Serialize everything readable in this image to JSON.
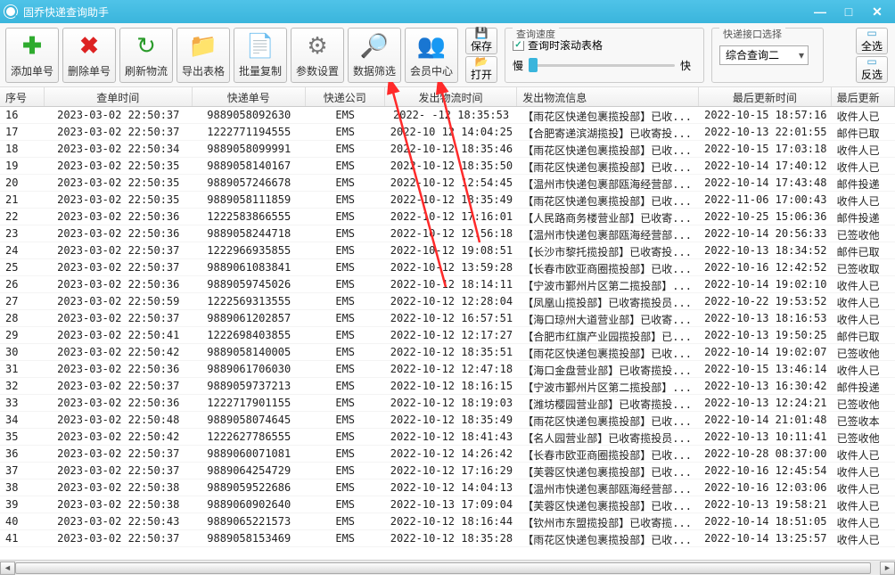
{
  "title": "固乔快递查询助手",
  "toolbar": {
    "add": "添加单号",
    "delete": "删除单号",
    "refresh": "刷新物流",
    "export": "导出表格",
    "copy": "批量复制",
    "settings": "参数设置",
    "filter": "数据筛选",
    "member": "会员中心",
    "save": "保存",
    "open": "打开",
    "selectAll": "全选",
    "invert": "反选"
  },
  "speed": {
    "label": "查询速度",
    "slow": "慢",
    "fast": "快",
    "scroll": "查询时滚动表格"
  },
  "interface": {
    "label": "快递接口选择",
    "value": "综合查询二"
  },
  "columns": [
    "序号",
    "查单时间",
    "快递单号",
    "快递公司",
    "发出物流时间",
    "发出物流信息",
    "最后更新时间",
    "最后更新"
  ],
  "rows": [
    [
      "16",
      "2023-03-02 22:50:37",
      "9889058092630",
      "EMS",
      "2022-  -12 18:35:53",
      "【雨花区快递包裹揽投部】已收...",
      "2022-10-15 18:57:16",
      "收件人已"
    ],
    [
      "17",
      "2023-03-02 22:50:37",
      "1222771194555",
      "EMS",
      "2022-10 12 14:04:25",
      "【合肥寄递滨湖揽投】已收寄投...",
      "2022-10-13 22:01:55",
      "邮件已取"
    ],
    [
      "18",
      "2023-03-02 22:50:34",
      "9889058099991",
      "EMS",
      "2022-10-12 18:35:46",
      "【雨花区快递包裹揽投部】已收...",
      "2022-10-15 17:03:18",
      "收件人已"
    ],
    [
      "19",
      "2023-03-02 22:50:35",
      "9889058140167",
      "EMS",
      "2022-10-12 18:35:50",
      "【雨花区快递包裹揽投部】已收...",
      "2022-10-14 17:40:12",
      "收件人已"
    ],
    [
      "20",
      "2023-03-02 22:50:35",
      "9889057246678",
      "EMS",
      "2022-10-12 12:54:45",
      "【温州市快递包裹部瓯海经营部...",
      "2022-10-14 17:43:48",
      "邮件投递"
    ],
    [
      "21",
      "2023-03-02 22:50:35",
      "9889058111859",
      "EMS",
      "2022-10-12 18:35:49",
      "【雨花区快递包裹揽投部】已收...",
      "2022-11-06 17:00:43",
      "收件人已"
    ],
    [
      "22",
      "2023-03-02 22:50:36",
      "1222583866555",
      "EMS",
      "2022-10-12 17:16:01",
      "【人民路商务楼营业部】已收寄...",
      "2022-10-25 15:06:36",
      "邮件投递"
    ],
    [
      "23",
      "2023-03-02 22:50:36",
      "9889058244718",
      "EMS",
      "2022-10-12 12:56:18",
      "【温州市快递包裹部瓯海经营部...",
      "2022-10-14 20:56:33",
      "已签收他"
    ],
    [
      "24",
      "2023-03-02 22:50:37",
      "1222966935855",
      "EMS",
      "2022-10-12 19:08:51",
      "【长沙市黎托揽投部】已收寄投...",
      "2022-10-13 18:34:52",
      "邮件已取"
    ],
    [
      "25",
      "2023-03-02 22:50:37",
      "9889061083841",
      "EMS",
      "2022-10-12 13:59:28",
      "【长春市欧亚商圈揽投部】已收...",
      "2022-10-16 12:42:52",
      "已签收取"
    ],
    [
      "26",
      "2023-03-02 22:50:36",
      "9889059745026",
      "EMS",
      "2022-10-12 18:14:11",
      "【宁波市鄞州片区第二揽投部】...",
      "2022-10-14 19:02:10",
      "收件人已"
    ],
    [
      "27",
      "2023-03-02 22:50:59",
      "1222569313555",
      "EMS",
      "2022-10-12 12:28:04",
      "【凤凰山揽投部】已收寄揽投员...",
      "2022-10-22 19:53:52",
      "收件人已"
    ],
    [
      "28",
      "2023-03-02 22:50:37",
      "9889061202857",
      "EMS",
      "2022-10-12 16:57:51",
      "【海口琼州大道营业部】已收寄...",
      "2022-10-13 18:16:53",
      "收件人已"
    ],
    [
      "29",
      "2023-03-02 22:50:41",
      "1222698403855",
      "EMS",
      "2022-10-12 12:17:27",
      "【合肥市红旗产业园揽投部】已...",
      "2022-10-13 19:50:25",
      "邮件已取"
    ],
    [
      "30",
      "2023-03-02 22:50:42",
      "9889058140005",
      "EMS",
      "2022-10-12 18:35:51",
      "【雨花区快递包裹揽投部】已收...",
      "2022-10-14 19:02:07",
      "已签收他"
    ],
    [
      "31",
      "2023-03-02 22:50:36",
      "9889061706030",
      "EMS",
      "2022-10-12 12:47:18",
      "【海口金盘营业部】已收寄揽投...",
      "2022-10-15 13:46:14",
      "收件人已"
    ],
    [
      "32",
      "2023-03-02 22:50:37",
      "9889059737213",
      "EMS",
      "2022-10-12 18:16:15",
      "【宁波市鄞州片区第二揽投部】...",
      "2022-10-13 16:30:42",
      "邮件投递"
    ],
    [
      "33",
      "2023-03-02 22:50:36",
      "1222717901155",
      "EMS",
      "2022-10-12 18:19:03",
      "【潍坊樱园营业部】已收寄揽投...",
      "2022-10-13 12:24:21",
      "已签收他"
    ],
    [
      "34",
      "2023-03-02 22:50:48",
      "9889058074645",
      "EMS",
      "2022-10-12 18:35:49",
      "【雨花区快递包裹揽投部】已收...",
      "2022-10-14 21:01:48",
      "已签收本"
    ],
    [
      "35",
      "2023-03-02 22:50:42",
      "1222627786555",
      "EMS",
      "2022-10-12 18:41:43",
      "【名人园营业部】已收寄揽投员...",
      "2022-10-13 10:11:41",
      "已签收他"
    ],
    [
      "36",
      "2023-03-02 22:50:37",
      "9889060071081",
      "EMS",
      "2022-10-12 14:26:42",
      "【长春市欧亚商圈揽投部】已收...",
      "2022-10-28 08:37:00",
      "收件人已"
    ],
    [
      "37",
      "2023-03-02 22:50:37",
      "9889064254729",
      "EMS",
      "2022-10-12 17:16:29",
      "【芙蓉区快递包裹揽投部】已收...",
      "2022-10-16 12:45:54",
      "收件人已"
    ],
    [
      "38",
      "2023-03-02 22:50:38",
      "9889059522686",
      "EMS",
      "2022-10-12 14:04:13",
      "【温州市快递包裹部瓯海经营部...",
      "2022-10-16 12:03:06",
      "收件人已"
    ],
    [
      "39",
      "2023-03-02 22:50:38",
      "9889060902640",
      "EMS",
      "2022-10-13 17:09:04",
      "【芙蓉区快递包裹揽投部】已收...",
      "2022-10-13 19:58:21",
      "收件人已"
    ],
    [
      "40",
      "2023-03-02 22:50:43",
      "9889065221573",
      "EMS",
      "2022-10-12 18:16:44",
      "【钦州市东盟揽投部】已收寄揽...",
      "2022-10-14 18:51:05",
      "收件人已"
    ],
    [
      "41",
      "2023-03-02 22:50:37",
      "9889058153469",
      "EMS",
      "2022-10-12 18:35:28",
      "【雨花区快递包裹揽投部】已收...",
      "2022-10-14 13:25:57",
      "收件人已"
    ]
  ]
}
